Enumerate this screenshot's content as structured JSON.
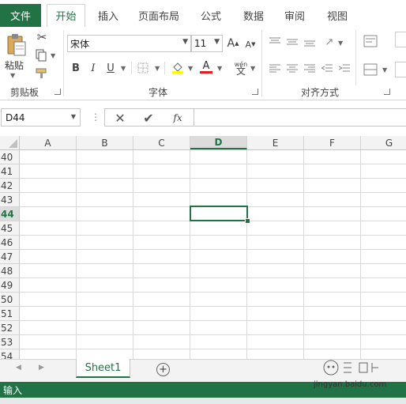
{
  "ribbon": {
    "tabs": [
      {
        "label": "文件"
      },
      {
        "label": "开始"
      },
      {
        "label": "插入"
      },
      {
        "label": "页面布局"
      },
      {
        "label": "公式"
      },
      {
        "label": "数据"
      },
      {
        "label": "审阅"
      },
      {
        "label": "视图"
      }
    ],
    "active_tab": "开始",
    "clipboard": {
      "paste_label": "粘贴",
      "group_label": "剪贴板"
    },
    "font": {
      "font_name": "宋体",
      "font_size": "11",
      "group_label": "字体",
      "bold": "B",
      "italic": "I",
      "underline": "U",
      "wen": "wén"
    },
    "alignment": {
      "group_label": "对齐方式"
    }
  },
  "formula_bar": {
    "name_box": "D44",
    "fx_label": "fx",
    "formula": ""
  },
  "grid": {
    "columns": [
      "A",
      "B",
      "C",
      "D",
      "E",
      "F",
      "G"
    ],
    "rows": [
      "40",
      "41",
      "42",
      "43",
      "44",
      "45",
      "46",
      "47",
      "48",
      "49",
      "50",
      "51",
      "52",
      "53",
      "54"
    ],
    "selected_column": "D",
    "selected_row": "44"
  },
  "sheets": {
    "tabs": [
      "Sheet1"
    ],
    "add_label": "+"
  },
  "status": {
    "text": "输入"
  },
  "watermark": {
    "text": "jingyan.baidu.com"
  },
  "colors": {
    "accent": "#217346",
    "font_color_bar": "#e01e1e",
    "highlight_bar": "#ffff00"
  }
}
